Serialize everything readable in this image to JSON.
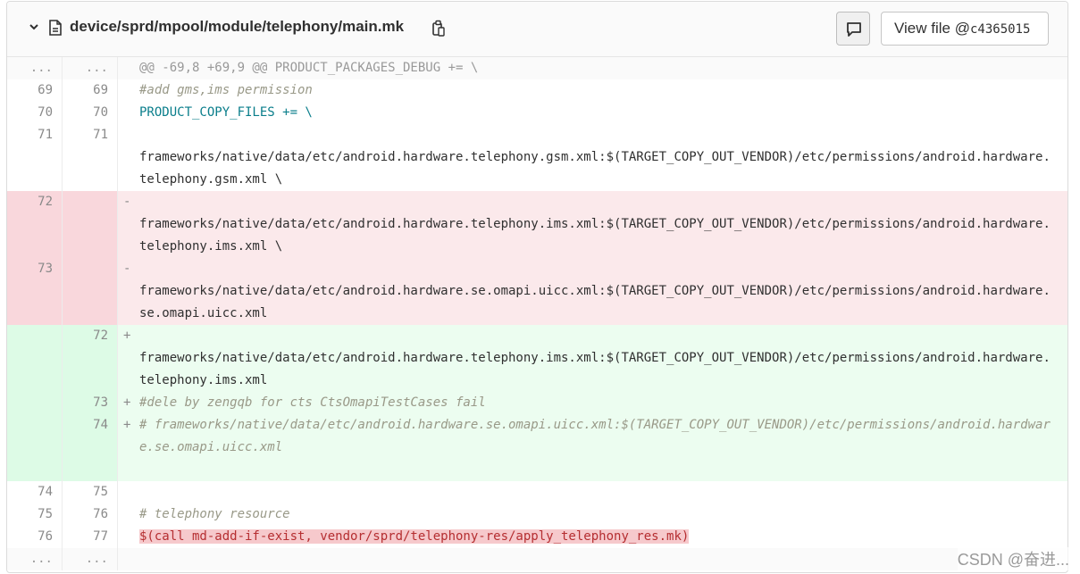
{
  "header": {
    "file_path": "device/sprd/mpool/module/telephony/main.mk",
    "view_file_label": "View file @",
    "commit_hash": "c4365015"
  },
  "diff": {
    "hunk": {
      "old": "...",
      "new": "...",
      "text": "@@ -69,8 +69,9 @@ PRODUCT_PACKAGES_DEBUG += \\"
    },
    "lines": [
      {
        "old": "69",
        "new": "69",
        "marker": "",
        "text": "#add gms,ims permission"
      },
      {
        "old": "70",
        "new": "70",
        "marker": "",
        "text": "PRODUCT_COPY_FILES += \\"
      },
      {
        "old": "71",
        "new": "71",
        "marker": "",
        "text": "frameworks/native/data/etc/android.hardware.telephony.gsm.xml:$(TARGET_COPY_OUT_VENDOR)/etc/permissions/android.hardware.telephony.gsm.xml \\"
      },
      {
        "old": "72",
        "new": "",
        "marker": "-",
        "text": "frameworks/native/data/etc/android.hardware.telephony.ims.xml:$(TARGET_COPY_OUT_VENDOR)/etc/permissions/android.hardware.telephony.ims.xml \\"
      },
      {
        "old": "73",
        "new": "",
        "marker": "-",
        "text": "frameworks/native/data/etc/android.hardware.se.omapi.uicc.xml:$(TARGET_COPY_OUT_VENDOR)/etc/permissions/android.hardware.se.omapi.uicc.xml"
      },
      {
        "old": "",
        "new": "72",
        "marker": "+",
        "text": "frameworks/native/data/etc/android.hardware.telephony.ims.xml:$(TARGET_COPY_OUT_VENDOR)/etc/permissions/android.hardware.telephony.ims.xml"
      },
      {
        "old": "",
        "new": "73",
        "marker": "+",
        "text": "#dele by zengqb for cts CtsOmapiTestCases fail"
      },
      {
        "old": "",
        "new": "74",
        "marker": "+",
        "text": "# frameworks/native/data/etc/android.hardware.se.omapi.uicc.xml:$(TARGET_COPY_OUT_VENDOR)/etc/permissions/android.hardware.se.omapi.uicc.xml"
      },
      {
        "old": "74",
        "new": "75",
        "marker": "",
        "text": ""
      },
      {
        "old": "75",
        "new": "76",
        "marker": "",
        "text": "# telephony resource"
      },
      {
        "old": "76",
        "new": "77",
        "marker": "",
        "text": "$(call md-add-if-exist, vendor/sprd/telephony-res/apply_telephony_res.mk)"
      },
      {
        "old": "...",
        "new": "...",
        "marker": "",
        "text": ""
      }
    ]
  },
  "watermark": "CSDN @奋进..."
}
